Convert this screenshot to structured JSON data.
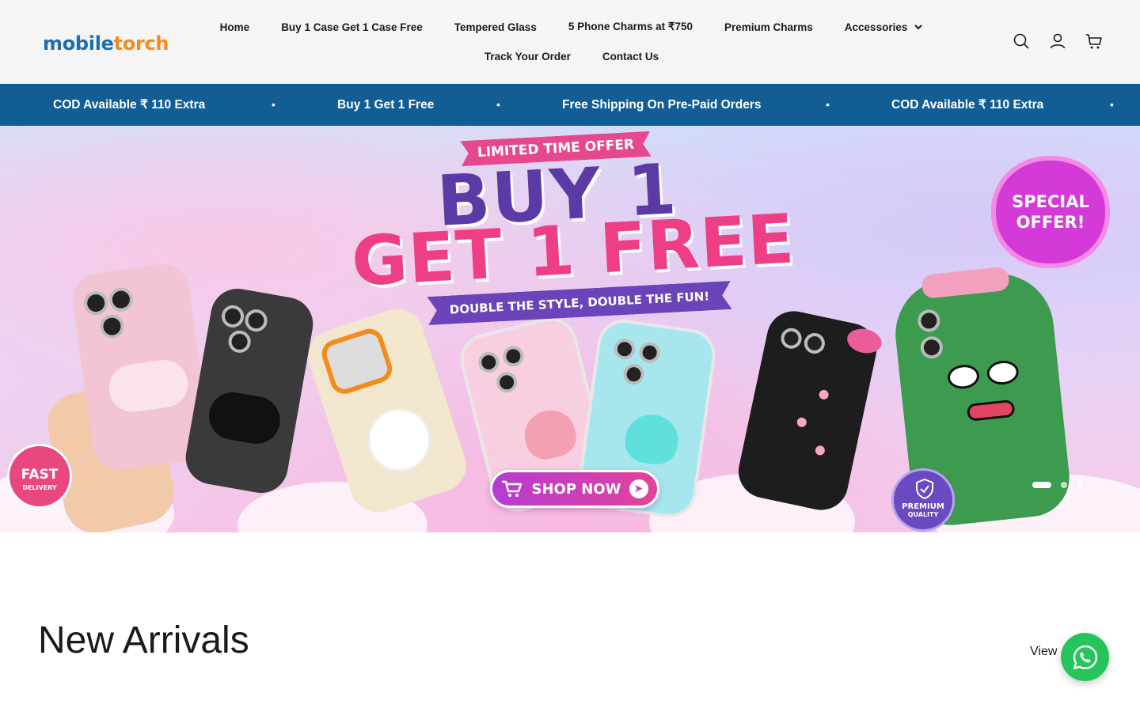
{
  "header": {
    "logo": {
      "part1": "mobile",
      "part2": "torch"
    },
    "nav_row1": [
      {
        "label": "Home"
      },
      {
        "label": "Buy 1 Case Get 1 Case Free"
      },
      {
        "label": "Tempered Glass"
      },
      {
        "label": "5 Phone Charms at ₹750"
      },
      {
        "label": "Premium Charms"
      },
      {
        "label": "Accessories"
      }
    ],
    "nav_row2": [
      {
        "label": "Track Your Order"
      },
      {
        "label": "Contact Us"
      }
    ],
    "icons": [
      "search-icon",
      "account-icon",
      "cart-icon"
    ]
  },
  "announcement": {
    "items": [
      "COD Available ₹ 110 Extra",
      "Buy 1 Get 1 Free",
      "Free Shipping On Pre-Paid Orders",
      "COD Available ₹ 110 Extra"
    ],
    "separator": "•"
  },
  "hero": {
    "ribbon": "LIMITED TIME OFFER",
    "headline1": "BUY 1",
    "headline2": "GET 1 FREE",
    "tagline": "DOUBLE THE STYLE, DOUBLE THE FUN!",
    "special_line1": "SPECIAL",
    "special_line2": "OFFER!",
    "cta": "SHOP NOW",
    "badge_fast_line1": "FAST",
    "badge_fast_line2": "DELIVERY",
    "badge_premium_line1": "PREMIUM",
    "badge_premium_line2": "QUALITY",
    "slides": {
      "count": 3,
      "active": 1
    }
  },
  "new_arrivals": {
    "title": "New Arrivals",
    "view_all": "View"
  },
  "colors": {
    "announcement_bg": "#125d94",
    "logo_blue": "#1b6fb0",
    "logo_orange": "#f28c1b",
    "whatsapp": "#25c55b"
  }
}
